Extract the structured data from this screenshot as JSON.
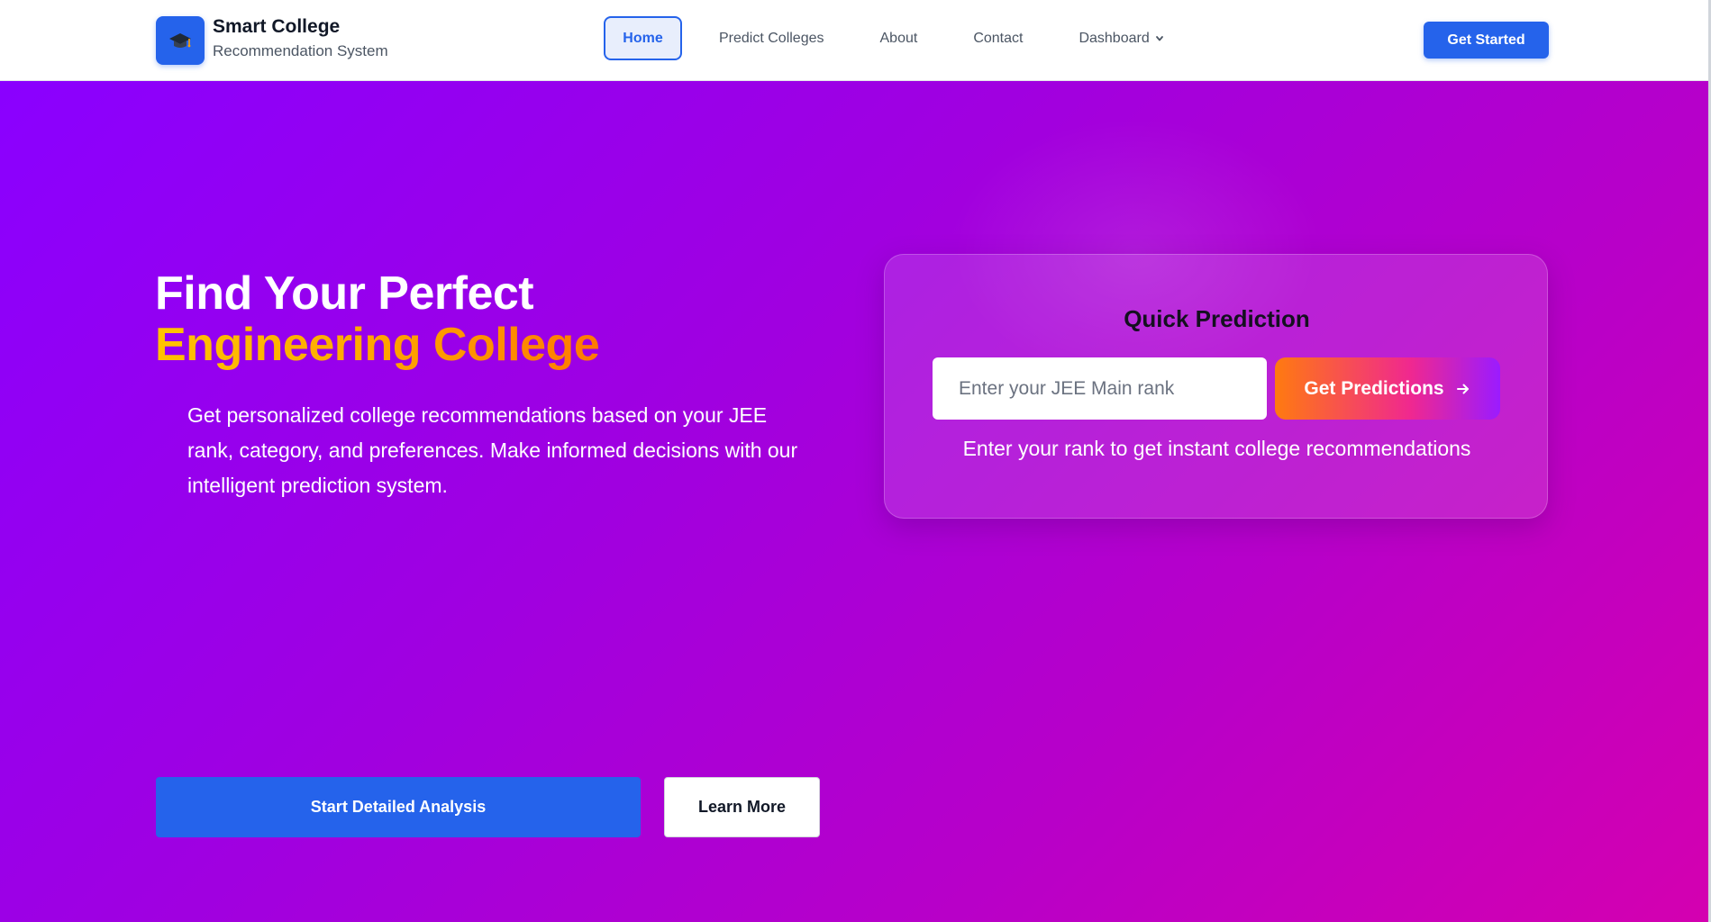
{
  "brand": {
    "title": "Smart College",
    "subtitle": "Recommendation System",
    "icon": "graduation-cap-icon"
  },
  "nav": {
    "home": "Home",
    "predict": "Predict Colleges",
    "about": "About",
    "contact": "Contact",
    "dashboard": "Dashboard",
    "active": "Home"
  },
  "header": {
    "cta_label": "Get Started"
  },
  "hero": {
    "title_line1": "Find Your Perfect",
    "title_line2": "Engineering College",
    "description": "Get personalized college recommendations based on your JEE rank, category, and preferences. Make informed decisions with our intelligent prediction system.",
    "primary_button": "Start Detailed Analysis",
    "secondary_button": "Learn More"
  },
  "quick_prediction": {
    "title": "Quick Prediction",
    "input_placeholder": "Enter your JEE Main rank",
    "input_value": "",
    "button_label": "Get Predictions",
    "help_text": "Enter your rank to get instant college recommendations"
  },
  "colors": {
    "accent": "#2563eb",
    "hero_gradient_start": "#8a00ff",
    "hero_gradient_end": "#d400b0",
    "highlight_start": "#ffc300",
    "highlight_end": "#ff7a00"
  }
}
